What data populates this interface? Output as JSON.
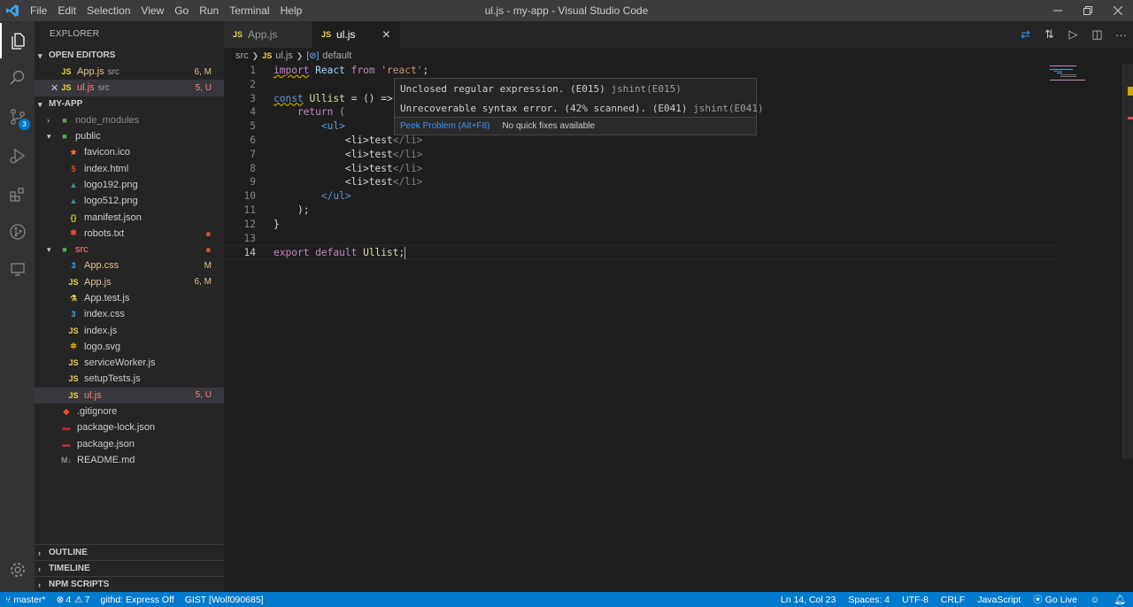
{
  "window": {
    "title": "ul.js - my-app - Visual Studio Code",
    "menu": [
      "File",
      "Edit",
      "Selection",
      "View",
      "Go",
      "Run",
      "Terminal",
      "Help"
    ]
  },
  "activity": {
    "scm_badge": "3"
  },
  "sidebar": {
    "title": "EXPLORER",
    "open_editors_header": "OPEN EDITORS",
    "open_editors": [
      {
        "badge": "JS",
        "name": "App.js",
        "desc": "src",
        "status": "6, M"
      },
      {
        "badge": "JS",
        "name": "ul.js",
        "desc": "src",
        "status": "5, U"
      }
    ],
    "project_header": "MY-APP",
    "tree": {
      "node_modules": "node_modules",
      "public": "public",
      "public_files": [
        "favicon.ico",
        "index.html",
        "logo192.png",
        "logo512.png",
        "manifest.json",
        "robots.txt"
      ],
      "src": "src",
      "src_files": [
        {
          "name": "App.css",
          "status": "M"
        },
        {
          "name": "App.js",
          "status": "6, M"
        },
        {
          "name": "App.test.js",
          "status": ""
        },
        {
          "name": "index.css",
          "status": ""
        },
        {
          "name": "index.js",
          "status": ""
        },
        {
          "name": "logo.svg",
          "status": ""
        },
        {
          "name": "serviceWorker.js",
          "status": ""
        },
        {
          "name": "setupTests.js",
          "status": ""
        },
        {
          "name": "ul.js",
          "status": "5, U"
        }
      ],
      "root_files": [
        ".gitignore",
        "package-lock.json",
        "package.json",
        "README.md"
      ]
    },
    "outline": "OUTLINE",
    "timeline": "TIMELINE",
    "npm": "NPM SCRIPTS"
  },
  "tabs": [
    {
      "badge": "JS",
      "label": "App.js"
    },
    {
      "badge": "JS",
      "label": "ul.js"
    }
  ],
  "breadcrumb": {
    "folder": "src",
    "file": "ul.js",
    "symbol": "default"
  },
  "editor": {
    "line_numbers": [
      "1",
      "2",
      "3",
      "4",
      "5",
      "6",
      "7",
      "8",
      "9",
      "10",
      "11",
      "12",
      "13",
      "14"
    ],
    "l1": {
      "import": "import",
      "name": "React",
      "from": "from",
      "str": "'react'",
      "end": ";"
    },
    "l3": {
      "const": "const",
      "name": "Ullist",
      "rest": " = () =>"
    },
    "l4": "return (",
    "ul_open": "<ul>",
    "li_text": "test",
    "li_open": "<li>",
    "li_close": "</li>",
    "ul_close": "</ul>",
    "l11": ");",
    "l12": "}",
    "l14": {
      "export": "export",
      "default": "default",
      "name": "Ullist",
      "end": ";"
    }
  },
  "hover": {
    "msg1": "Unclosed regular expression. (E015)",
    "src1": "jshint(E015)",
    "msg2": "Unrecoverable syntax error. (42% scanned). (E041)",
    "src2": "jshint(E041)",
    "peek": "Peek Problem (Alt+F8)",
    "nofix": "No quick fixes available"
  },
  "status": {
    "branch": "master*",
    "errors": "4",
    "warnings": "7",
    "githd": "githd: Express Off",
    "gist": "GIST [Wolf090685]",
    "position": "Ln 14, Col 23",
    "spaces": "Spaces: 4",
    "encoding": "UTF-8",
    "eol": "CRLF",
    "language": "JavaScript",
    "golive": "Go Live"
  }
}
